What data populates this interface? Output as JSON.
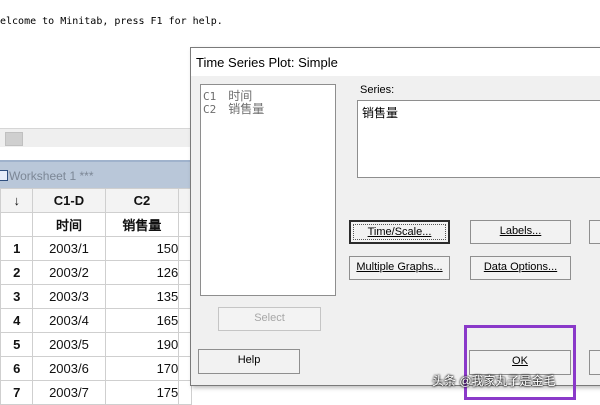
{
  "session": {
    "welcome_text": "elcome to Minitab, press F1 for help."
  },
  "worksheet": {
    "title": "Worksheet 1 ***",
    "arrow_header": "↓",
    "column_headers": [
      "C1-D",
      "C2"
    ],
    "column_names": [
      "时间",
      "销售量"
    ],
    "rows": [
      {
        "num": "1",
        "c1": "2003/1",
        "c2": "150"
      },
      {
        "num": "2",
        "c1": "2003/2",
        "c2": "126"
      },
      {
        "num": "3",
        "c1": "2003/3",
        "c2": "135"
      },
      {
        "num": "4",
        "c1": "2003/4",
        "c2": "165"
      },
      {
        "num": "5",
        "c1": "2003/5",
        "c2": "190"
      },
      {
        "num": "6",
        "c1": "2003/6",
        "c2": "170"
      },
      {
        "num": "7",
        "c1": "2003/7",
        "c2": "175"
      }
    ]
  },
  "dialog": {
    "title": "Time Series Plot: Simple",
    "variables": [
      {
        "col": "C1",
        "name": "时间"
      },
      {
        "col": "C2",
        "name": "销售量"
      }
    ],
    "series_label": "Series:",
    "series_value": "销售量",
    "buttons": {
      "time_scale": "Time/Scale...",
      "labels": "Labels...",
      "multiple_graphs": "Multiple Graphs...",
      "data_options": "Data Options...",
      "select": "Select",
      "help": "Help",
      "ok": "OK"
    }
  },
  "watermark": "头条 @我家丸子是金毛",
  "colors": {
    "highlight": "#8a39c9",
    "worksheet_title_bg": "#b9c7d9"
  }
}
